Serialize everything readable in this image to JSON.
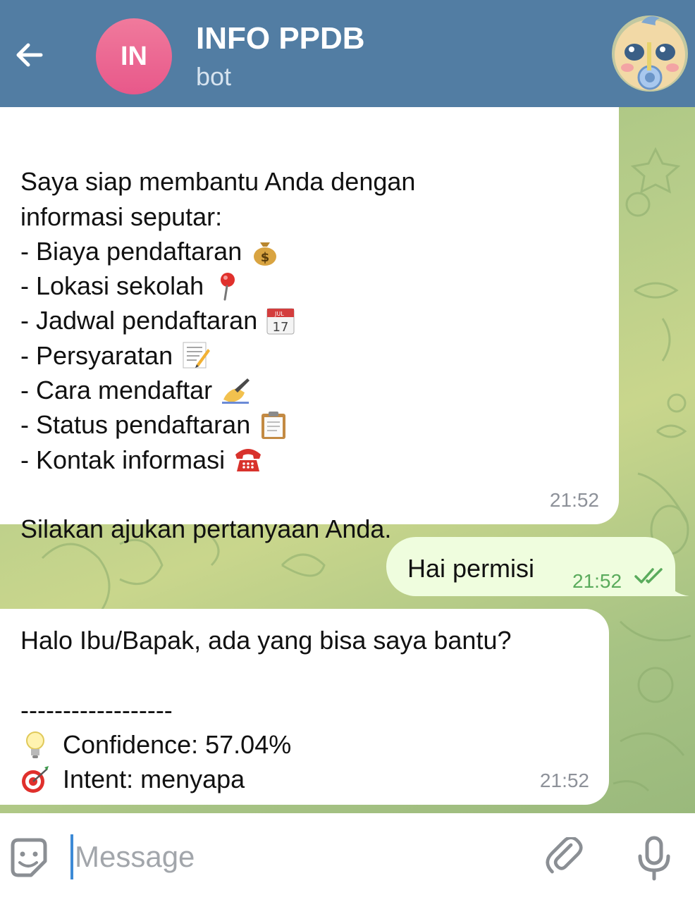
{
  "header": {
    "avatar_initials": "IN",
    "title": "INFO PPDB",
    "subtitle": "bot",
    "background_color": "#527da3",
    "avatar_color": "#ec6b94"
  },
  "messages": [
    {
      "sender": "bot",
      "lines": [
        {
          "text": "",
          "emoji": ""
        },
        {
          "text": "Saya siap membantu Anda dengan",
          "emoji": ""
        },
        {
          "text": "informasi seputar:",
          "emoji": ""
        },
        {
          "text": "- Biaya pendaftaran",
          "emoji": "money-bag"
        },
        {
          "text": "- Lokasi sekolah",
          "emoji": "round-pushpin"
        },
        {
          "text": "- Jadwal pendaftaran",
          "emoji": "calendar"
        },
        {
          "text": "- Persyaratan",
          "emoji": "memo"
        },
        {
          "text": "- Cara mendaftar",
          "emoji": "writing-hand"
        },
        {
          "text": "- Status pendaftaran",
          "emoji": "clipboard"
        },
        {
          "text": "- Kontak informasi",
          "emoji": "telephone"
        },
        {
          "text": "",
          "emoji": ""
        },
        {
          "text": "Silakan ajukan pertanyaan Anda.",
          "emoji": ""
        }
      ],
      "time": "21:52"
    },
    {
      "sender": "user",
      "text": "Hai permisi",
      "time": "21:52",
      "status": "read-double-check"
    },
    {
      "sender": "bot",
      "greeting": "Halo Ibu/Bapak, ada yang bisa saya bantu?",
      "divider": "------------------",
      "confidence_label": "Confidence: 57.04%",
      "intent_label": "Intent: menyapa",
      "confidence_emoji": "light-bulb",
      "intent_emoji": "direct-hit",
      "time": "21:52"
    }
  ],
  "composer": {
    "placeholder": "Message",
    "value": ""
  },
  "colors": {
    "outgoing_bubble": "#effdde",
    "incoming_bubble": "#ffffff",
    "outgoing_time": "#5aab5c",
    "chat_background": "#b3cc88"
  }
}
